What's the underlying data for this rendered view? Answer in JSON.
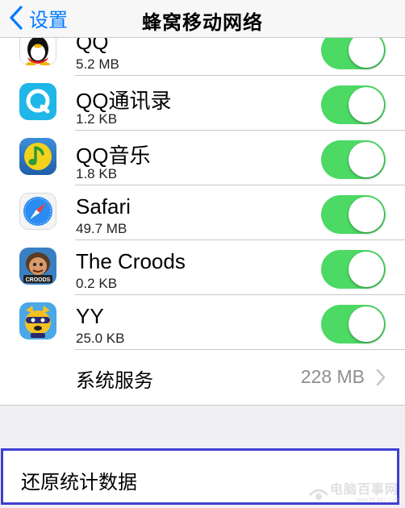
{
  "nav": {
    "back_label": "设置",
    "title": "蜂窝移动网络"
  },
  "apps": [
    {
      "name": "QQ",
      "size": "5.2 MB",
      "icon": "qq-penguin-icon",
      "enabled": true
    },
    {
      "name": "QQ通讯录",
      "size": "1.2 KB",
      "icon": "qq-contacts-icon",
      "enabled": true
    },
    {
      "name": "QQ音乐",
      "size": "1.8 KB",
      "icon": "qq-music-icon",
      "enabled": true
    },
    {
      "name": "Safari",
      "size": "49.7 MB",
      "icon": "safari-compass-icon",
      "enabled": true
    },
    {
      "name": "The Croods",
      "size": "0.2 KB",
      "icon": "croods-game-icon",
      "enabled": true
    },
    {
      "name": "YY",
      "size": "25.0 KB",
      "icon": "yy-raccoon-icon",
      "enabled": true
    }
  ],
  "system_services": {
    "label": "系统服务",
    "value": "228 MB"
  },
  "reset": {
    "label": "还原统计数据"
  },
  "watermark": {
    "text": "电脑百事网",
    "sub": "www.PC841.com"
  },
  "colors": {
    "accent": "#007aff",
    "toggle_on": "#4cd964",
    "highlight_border": "#3f3fcf",
    "background": "#efeff4"
  }
}
